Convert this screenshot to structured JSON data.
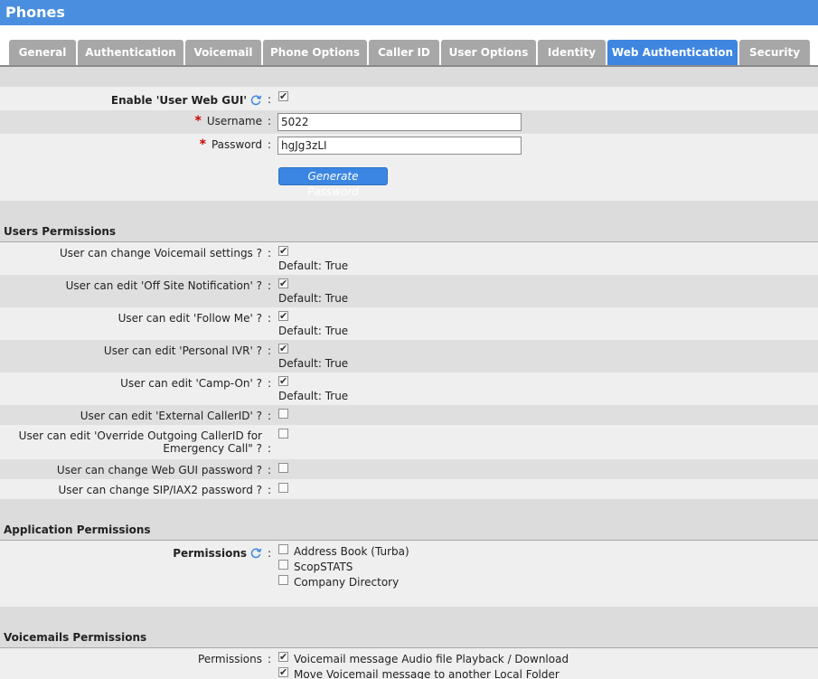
{
  "app_title": "Phones",
  "tabs": [
    {
      "label": "General",
      "active": false
    },
    {
      "label": "Authentication",
      "active": false
    },
    {
      "label": "Voicemail",
      "active": false
    },
    {
      "label": "Phone Options",
      "active": false
    },
    {
      "label": "Caller ID",
      "active": false
    },
    {
      "label": "User Options",
      "active": false
    },
    {
      "label": "Identity",
      "active": false
    },
    {
      "label": "Web Authentication",
      "active": true
    },
    {
      "label": "Security",
      "active": false
    }
  ],
  "web_gui": {
    "enable_label": "Enable 'User Web GUI'",
    "enable_checked": true,
    "username_label": "Username",
    "username_value": "5022",
    "password_label": "Password",
    "password_value": "hgJg3zLI",
    "generate_button": "Generate Password",
    "required_mark": "*",
    "colon": ":"
  },
  "users_permissions": {
    "header": "Users Permissions",
    "items": [
      {
        "label": "User can change Voicemail settings ?",
        "checked": true,
        "default": "Default: True"
      },
      {
        "label": "User can edit 'Off Site Notification' ?",
        "checked": true,
        "default": "Default: True"
      },
      {
        "label": "User can edit 'Follow Me' ?",
        "checked": true,
        "default": "Default: True"
      },
      {
        "label": "User can edit 'Personal IVR' ?",
        "checked": true,
        "default": "Default: True"
      },
      {
        "label": "User can edit 'Camp-On' ?",
        "checked": true,
        "default": "Default: True"
      },
      {
        "label": "User can edit 'External CallerID' ?",
        "checked": false
      },
      {
        "label": "User can edit 'Override Outgoing CallerID for",
        "label2": "Emergency Call\" ?",
        "checked": false
      },
      {
        "label": "User can change Web GUI password ?",
        "checked": false
      },
      {
        "label": "User can change SIP/IAX2 password ?",
        "checked": false
      }
    ]
  },
  "application_permissions": {
    "header": "Application Permissions",
    "label": "Permissions",
    "options": [
      {
        "label": "Address Book (Turba)",
        "checked": false
      },
      {
        "label": "ScopSTATS",
        "checked": false
      },
      {
        "label": "Company Directory",
        "checked": false
      }
    ]
  },
  "voicemails_permissions": {
    "header": "Voicemails Permissions",
    "label": "Permissions",
    "options": [
      {
        "label": "Voicemail message Audio file Playback / Download",
        "checked": true
      },
      {
        "label": "Move Voicemail message to another Local Folder",
        "checked": true
      }
    ]
  },
  "colors": {
    "accent": "#3f86e0",
    "tab_inactive": "#a7a7a7",
    "required": "#cc0000"
  }
}
